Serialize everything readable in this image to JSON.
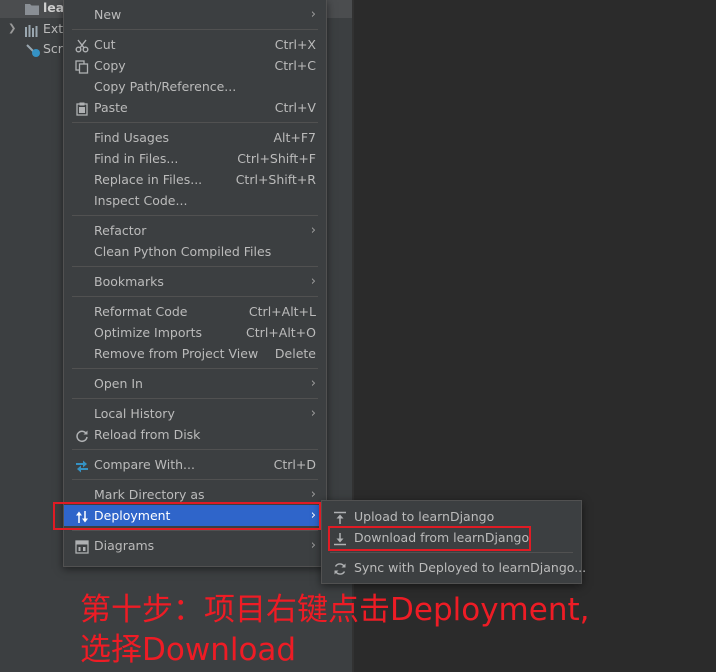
{
  "tree": {
    "items": [
      {
        "label": "lea"
      },
      {
        "label": "Ext"
      },
      {
        "label": "Scr"
      }
    ]
  },
  "context_menu": {
    "groups": [
      [
        {
          "label": "New",
          "submenu": true,
          "icon": "none"
        }
      ],
      [
        {
          "label": "Cut",
          "shortcut": "Ctrl+X",
          "icon": "scissors-icon"
        },
        {
          "label": "Copy",
          "shortcut": "Ctrl+C",
          "icon": "copy-icon"
        },
        {
          "label": "Copy Path/Reference...",
          "icon": "none"
        },
        {
          "label": "Paste",
          "shortcut": "Ctrl+V",
          "icon": "paste-icon"
        }
      ],
      [
        {
          "label": "Find Usages",
          "shortcut": "Alt+F7"
        },
        {
          "label": "Find in Files...",
          "shortcut": "Ctrl+Shift+F"
        },
        {
          "label": "Replace in Files...",
          "shortcut": "Ctrl+Shift+R"
        },
        {
          "label": "Inspect Code..."
        }
      ],
      [
        {
          "label": "Refactor",
          "submenu": true
        },
        {
          "label": "Clean Python Compiled Files"
        }
      ],
      [
        {
          "label": "Bookmarks",
          "submenu": true
        }
      ],
      [
        {
          "label": "Reformat Code",
          "shortcut": "Ctrl+Alt+L"
        },
        {
          "label": "Optimize Imports",
          "shortcut": "Ctrl+Alt+O"
        },
        {
          "label": "Remove from Project View",
          "shortcut": "Delete"
        }
      ],
      [
        {
          "label": "Open In",
          "submenu": true
        }
      ],
      [
        {
          "label": "Local History",
          "submenu": true
        },
        {
          "label": "Reload from Disk",
          "icon": "reload-icon"
        }
      ],
      [
        {
          "label": "Compare With...",
          "shortcut": "Ctrl+D",
          "icon": "compare-icon"
        }
      ],
      [
        {
          "label": "Mark Directory as",
          "submenu": true
        },
        {
          "label": "Deployment",
          "submenu": true,
          "icon": "deployment-icon",
          "highlighted": true
        }
      ],
      [
        {
          "label": "Diagrams",
          "submenu": true,
          "icon": "diagram-icon"
        }
      ]
    ]
  },
  "submenu": {
    "items": [
      {
        "label": "Upload to learnDjango",
        "icon": "upload-icon"
      },
      {
        "label": "Download from learnDjango",
        "icon": "download-icon"
      },
      {
        "label": "Sync with Deployed to learnDjango...",
        "icon": "sync-icon"
      }
    ]
  },
  "annotation": {
    "line1": "第十步：项目右键点击Deployment,",
    "line2": "选择Download"
  },
  "colors": {
    "menu_bg": "#3c3f41",
    "highlight": "#2f65ca",
    "annotation_red": "#e01b24",
    "text": "#bbbbbb"
  }
}
